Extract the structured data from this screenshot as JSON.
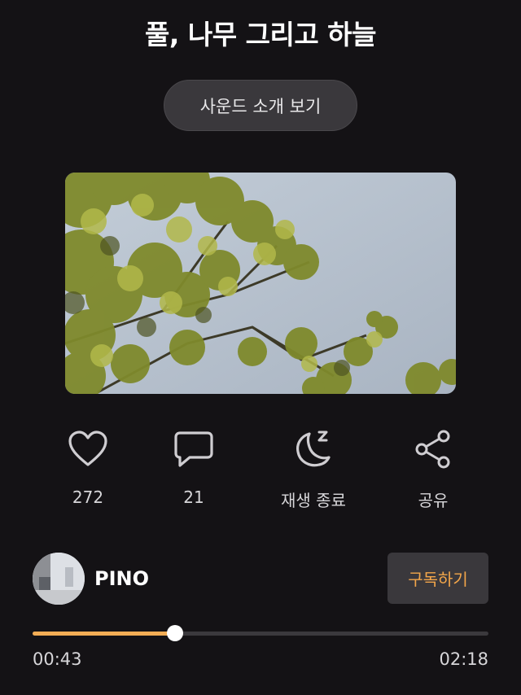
{
  "title": "풀, 나무 그리고 하늘",
  "intro_button": "사운드 소개 보기",
  "actions": {
    "like": {
      "icon": "heart-icon",
      "label": "272"
    },
    "comment": {
      "icon": "comment-icon",
      "label": "21"
    },
    "sleep_timer": {
      "icon": "moon-icon",
      "label": "재생 종료"
    },
    "share": {
      "icon": "share-icon",
      "label": "공유"
    }
  },
  "channel": {
    "name": "PINO",
    "subscribe_label": "구독하기"
  },
  "player": {
    "current_time": "00:43",
    "total_time": "02:18",
    "progress": 0.312
  },
  "colors": {
    "background": "#141215",
    "accent": "#f3ad55",
    "button_bg": "#3a383c"
  }
}
